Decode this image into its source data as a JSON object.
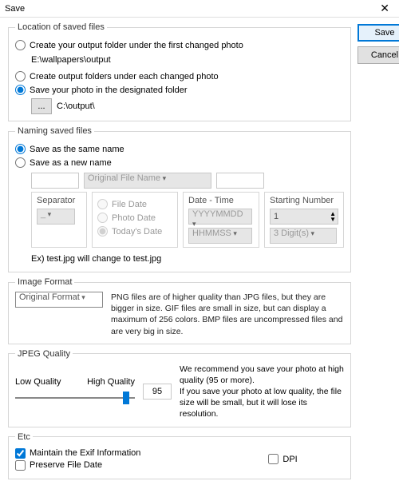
{
  "window": {
    "title": "Save"
  },
  "buttons": {
    "save": "Save",
    "cancel": "Cancel",
    "browse": "..."
  },
  "location": {
    "legend": "Location of saved files",
    "opt1": "Create your output folder under the first changed photo",
    "opt1_path": "E:\\wallpapers\\output",
    "opt2": "Create output folders under each changed photo",
    "opt3": "Save your photo in the designated folder",
    "opt3_path": "C:\\output\\",
    "selected": 3
  },
  "naming": {
    "legend": "Naming saved files",
    "opt1": "Save as the same name",
    "opt2": "Save as a new name",
    "selected": 1,
    "original_placeholder": "Original File Name",
    "separator_label": "Separator",
    "separator_value": "_",
    "datetype_label": "",
    "opt_file_date": "File Date",
    "opt_photo_date": "Photo Date",
    "opt_todays_date": "Today's Date",
    "datetime_label": "Date - Time",
    "date_format": "YYYYMMDD",
    "time_format": "HHMMSS",
    "startnum_label": "Starting Number",
    "startnum_value": "1",
    "digits_value": "3 Digit(s)",
    "example": "Ex) test.jpg will change to test.jpg"
  },
  "format": {
    "legend": "Image Format",
    "value": "Original Format",
    "desc": "PNG files are of higher quality than JPG files, but they are bigger in size. GIF files are small in size, but can display a maximum of 256 colors. BMP files are uncompressed files and are very big in size."
  },
  "jpeg": {
    "legend": "JPEG Quality",
    "low": "Low Quality",
    "high": "High Quality",
    "value": "95",
    "desc": "We recommend you save your photo at high quality (95 or more).\nIf you save your photo at low quality, the file size will be small, but it will lose its resolution."
  },
  "etc": {
    "legend": "Etc",
    "exif": "Maintain the Exif Information",
    "preserve": "Preserve File Date",
    "dpi": "DPI",
    "exif_checked": true,
    "preserve_checked": false,
    "dpi_checked": false
  }
}
